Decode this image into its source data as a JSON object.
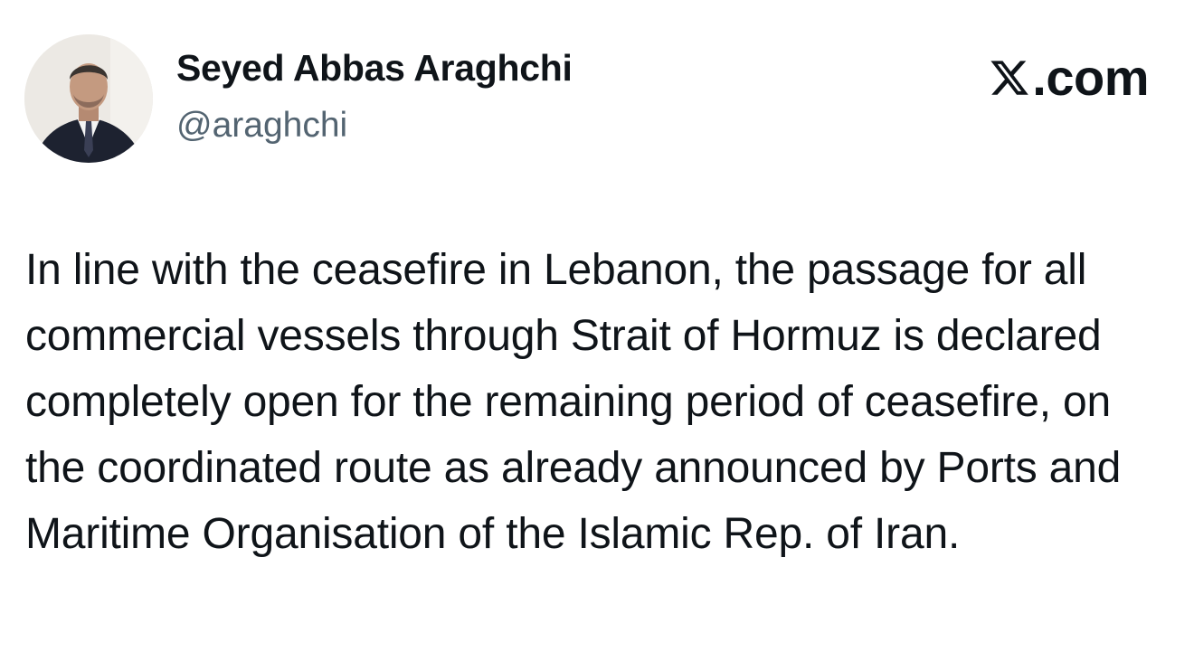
{
  "author": {
    "display_name": "Seyed Abbas Araghchi",
    "handle": "@araghchi",
    "avatar_icon": "profile-photo"
  },
  "brand": {
    "logo_icon": "x-logo-icon",
    "domain": ".com"
  },
  "tweet": {
    "text": "In line with the ceasefire in Lebanon, the passage for all commercial vessels through Strait of Hormuz is declared completely open for the remaining period of ceasefire, on the coordinated route as already announced by Ports and Maritime Organisation of the Islamic Rep. of Iran."
  },
  "colors": {
    "text_primary": "#0f1419",
    "text_secondary": "#536471",
    "background": "#ffffff"
  }
}
